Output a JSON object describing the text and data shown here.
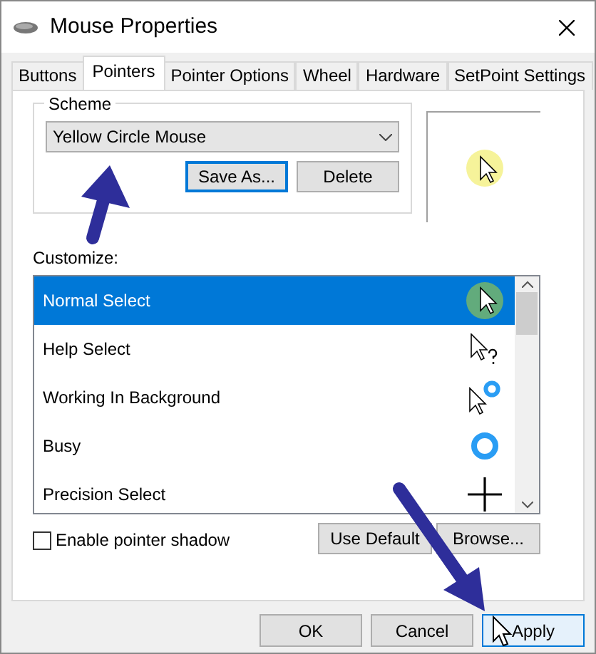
{
  "window": {
    "title": "Mouse Properties"
  },
  "tabs": [
    {
      "label": "Buttons",
      "selected": false
    },
    {
      "label": "Pointers",
      "selected": true
    },
    {
      "label": "Pointer Options",
      "selected": false
    },
    {
      "label": "Wheel",
      "selected": false
    },
    {
      "label": "Hardware",
      "selected": false
    },
    {
      "label": "SetPoint Settings",
      "selected": false
    }
  ],
  "scheme": {
    "label": "Scheme",
    "value": "Yellow Circle Mouse",
    "buttons": [
      {
        "label": "Save As...",
        "focused": true
      },
      {
        "label": "Delete",
        "focused": false
      }
    ]
  },
  "customize": {
    "label": "Customize:",
    "items": [
      {
        "label": "Normal Select",
        "kind": "arrow",
        "selected": true
      },
      {
        "label": "Help Select",
        "kind": "help",
        "selected": false
      },
      {
        "label": "Working In Background",
        "kind": "background",
        "selected": false
      },
      {
        "label": "Busy",
        "kind": "busy",
        "selected": false
      },
      {
        "label": "Precision Select",
        "kind": "precision",
        "selected": false
      }
    ],
    "buttons": [
      "Use Default",
      "Browse..."
    ]
  },
  "pointer_shadow": {
    "label": "Enable pointer shadow",
    "checked": false
  },
  "buttons": [
    {
      "label": "OK",
      "hovered": false
    },
    {
      "label": "Cancel",
      "hovered": false
    },
    {
      "label": "Apply",
      "hovered": true
    }
  ]
}
